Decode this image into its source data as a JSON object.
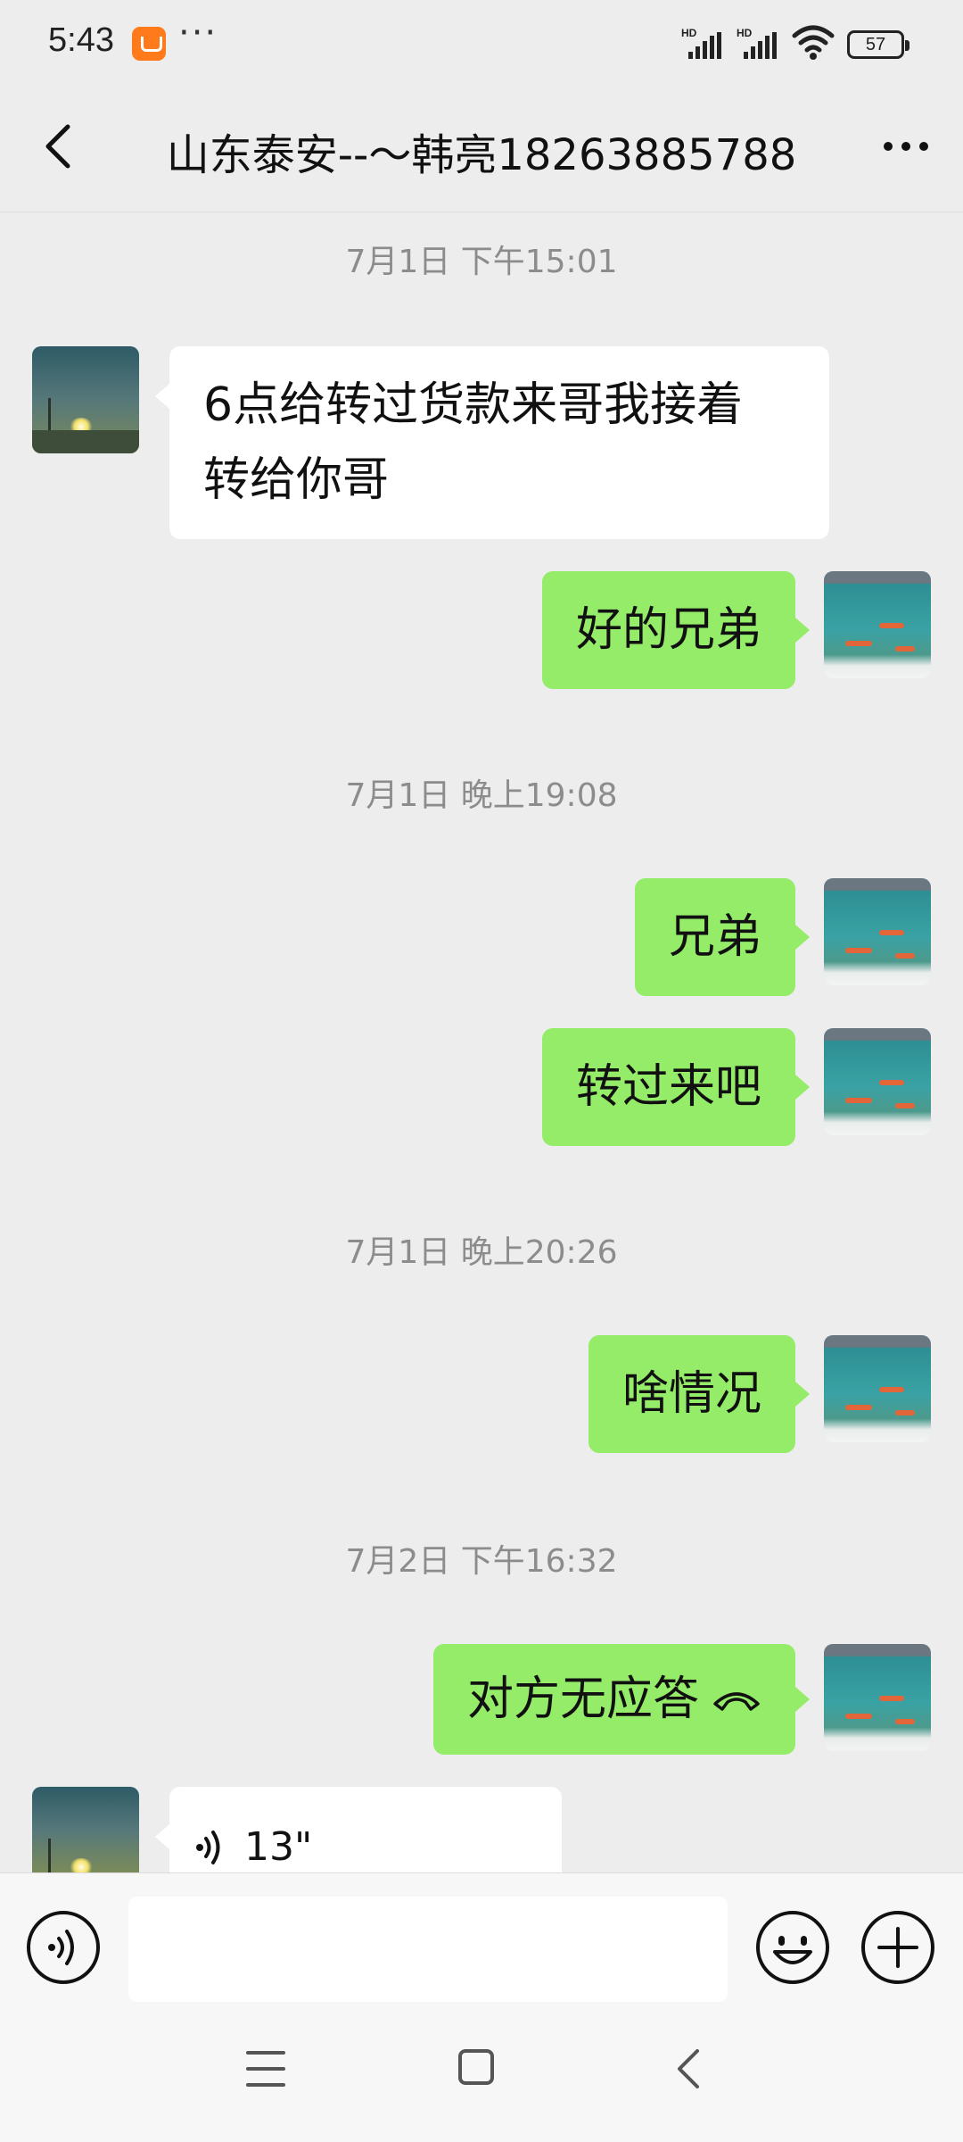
{
  "status_bar": {
    "time": "5:43",
    "more": "···",
    "signal_1_label": "HD",
    "signal_2_label": "HD",
    "battery": "57"
  },
  "header": {
    "title": "山东泰安--～韩亮18263885788"
  },
  "messages": [
    {
      "type": "timestamp",
      "text": "7月1日 下午15:01"
    },
    {
      "type": "text",
      "side": "left",
      "text_lines": [
        "6点给转过货款来哥我接着",
        "转给你哥"
      ]
    },
    {
      "type": "text",
      "side": "right",
      "text": "好的兄弟"
    },
    {
      "type": "timestamp",
      "text": "7月1日 晚上19:08"
    },
    {
      "type": "text",
      "side": "right",
      "text": "兄弟"
    },
    {
      "type": "text",
      "side": "right",
      "text": "转过来吧"
    },
    {
      "type": "timestamp",
      "text": "7月1日 晚上20:26"
    },
    {
      "type": "text",
      "side": "right",
      "text": "啥情况"
    },
    {
      "type": "timestamp",
      "text": "7月2日 下午16:32"
    },
    {
      "type": "call",
      "side": "right",
      "text": "对方无应答",
      "icon": "phone-hangup-icon"
    },
    {
      "type": "voice",
      "side": "left",
      "duration": "13\"",
      "icon": "voice-wave-icon"
    }
  ],
  "input_bar": {
    "voice_icon": "voice-mode-icon",
    "input_value": "",
    "emoji_icon": "emoji-icon",
    "plus_icon": "plus-icon"
  },
  "nav_bar": {
    "menu_icon": "menu-icon",
    "home_icon": "home-icon",
    "back_icon": "back-icon"
  },
  "colors": {
    "background": "#ededed",
    "bubble_sent": "#95ec69",
    "bubble_received": "#ffffff",
    "timestamp_text": "#8c8c8c"
  }
}
